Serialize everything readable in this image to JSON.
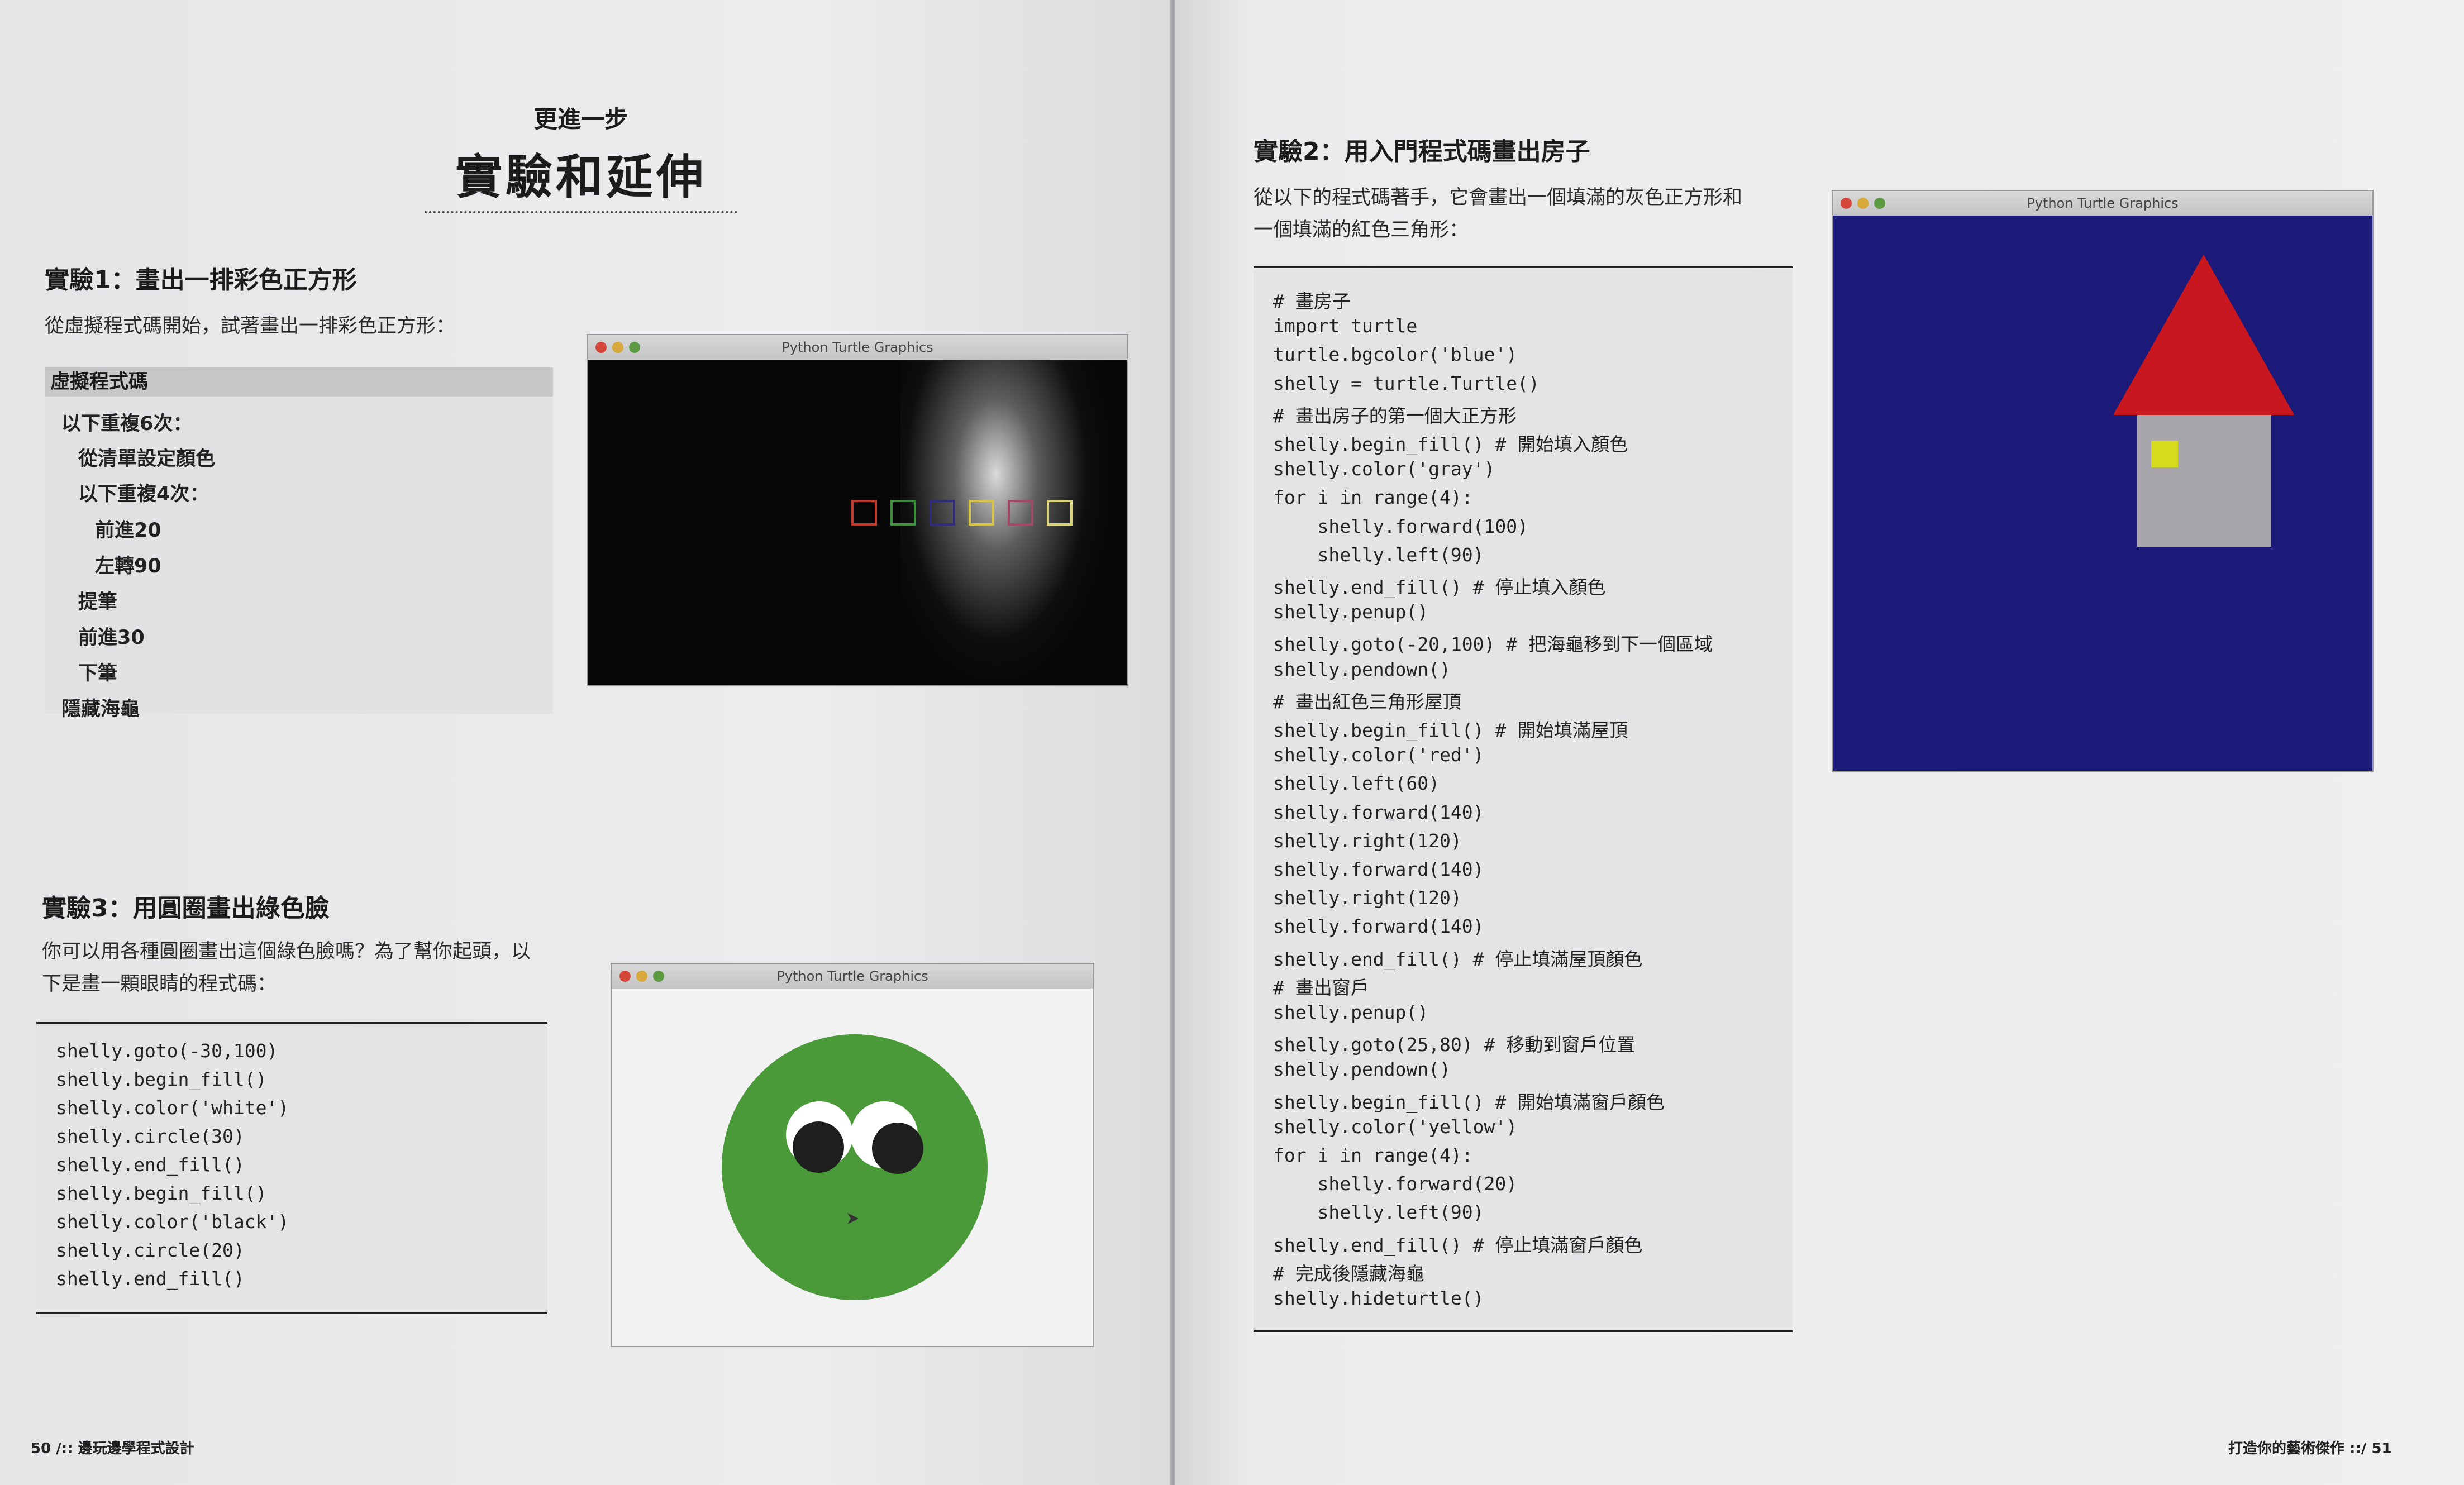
{
  "left_page": {
    "pre_title": "更進一步",
    "title": "實驗和延伸",
    "exp1": {
      "heading": "實驗1：畫出一排彩色正方形",
      "intro": "從虛擬程式碼開始，試著畫出一排彩色正方形：",
      "pseudo_heading": "虛擬程式碼",
      "pseudo_lines": [
        "以下重複6次：",
        "從清單設定顏色",
        "以下重複4次：",
        "前進20",
        "左轉90",
        "提筆",
        "前進30",
        "下筆",
        "隱藏海龜"
      ],
      "window_title": "Python Turtle Graphics",
      "square_colors": [
        "#c0392b",
        "#3d8b3d",
        "#2d2d7a",
        "#d6c34a",
        "#a04a6a",
        "#d8d27a"
      ]
    },
    "exp3": {
      "heading": "實驗3：用圓圈畫出綠色臉",
      "intro_line1": "你可以用各種圓圈畫出這個綠色臉嗎？為了幫你起頭，以",
      "intro_line2": "下是畫一顆眼睛的程式碼：",
      "code_lines": [
        "shelly.goto(-30,100)",
        "shelly.begin_fill()",
        "shelly.color('white')",
        "shelly.circle(30)",
        "shelly.end_fill()",
        "shelly.begin_fill()",
        "shelly.color('black')",
        "shelly.circle(20)",
        "shelly.end_fill()"
      ],
      "window_title": "Python Turtle Graphics",
      "face_color": "#4a9a3a"
    },
    "footer": "50 /:: 邊玩邊學程式設計"
  },
  "right_page": {
    "exp2": {
      "heading": "實驗2：用入門程式碼畫出房子",
      "intro_line1": "從以下的程式碼著手，它會畫出一個填滿的灰色正方形和",
      "intro_line2": "一個填滿的紅色三角形：",
      "code_lines": [
        "# 畫房子",
        "import turtle",
        "turtle.bgcolor('blue')",
        "shelly = turtle.Turtle()",
        "# 畫出房子的第一個大正方形",
        "shelly.begin_fill() # 開始填入顏色",
        "shelly.color('gray')",
        "for i in range(4):",
        "    shelly.forward(100)",
        "    shelly.left(90)",
        "shelly.end_fill() # 停止填入顏色",
        "shelly.penup()",
        "shelly.goto(-20,100) # 把海龜移到下一個區域",
        "shelly.pendown()",
        "# 畫出紅色三角形屋頂",
        "shelly.begin_fill() # 開始填滿屋頂",
        "shelly.color('red')",
        "shelly.left(60)",
        "shelly.forward(140)",
        "shelly.right(120)",
        "shelly.forward(140)",
        "shelly.right(120)",
        "shelly.forward(140)",
        "shelly.end_fill() # 停止填滿屋頂顏色",
        "# 畫出窗戶",
        "shelly.penup()",
        "shelly.goto(25,80) # 移動到窗戶位置",
        "shelly.pendown()",
        "shelly.begin_fill() # 開始填滿窗戶顏色",
        "shelly.color('yellow')",
        "for i in range(4):",
        "    shelly.forward(20)",
        "    shelly.left(90)",
        "shelly.end_fill() # 停止填滿窗戶顏色",
        "# 完成後隱藏海龜",
        "shelly.hideturtle()"
      ],
      "window_title": "Python Turtle Graphics",
      "bg_color": "#1c1a78",
      "roof_color": "#c8171e",
      "wall_color": "#a9a5ac",
      "window_color": "#d6dc1c"
    },
    "footer": "打造你的藝術傑作 ::/ 51"
  }
}
